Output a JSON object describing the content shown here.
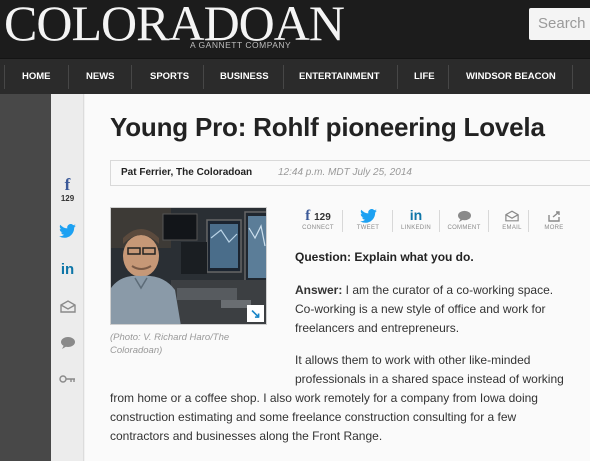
{
  "masthead": {
    "logo": "COLORADOAN",
    "tagline": "A GANNETT COMPANY",
    "search_placeholder": "Search"
  },
  "nav": {
    "items": [
      {
        "label": "HOME"
      },
      {
        "label": "NEWS"
      },
      {
        "label": "SPORTS"
      },
      {
        "label": "BUSINESS"
      },
      {
        "label": "ENTERTAINMENT"
      },
      {
        "label": "LIFE"
      },
      {
        "label": "WINDSOR BEACON"
      }
    ]
  },
  "share_rail": {
    "facebook_count": "129",
    "icons": [
      "facebook-icon",
      "twitter-icon",
      "linkedin-icon",
      "email-icon",
      "comment-icon",
      "more-icon"
    ]
  },
  "article": {
    "headline": "Young Pro: Rohlf pioneering Lovela",
    "author": "Pat Ferrier, The Coloradoan",
    "timestamp": "12:44 p.m. MDT July 25, 2014",
    "photo_caption": "(Photo: V. Richard Haro/The Coloradoan)",
    "question": "Question: Explain what you do.",
    "answer_label": "Answer:",
    "answer_lines": [
      " I am the curator of a co-working space.",
      "Co-working is a new style of office and work for",
      "freelancers and entrepreneurs."
    ],
    "para2_lines": [
      "It allows them to work with other like-minded",
      "professionals in a shared space instead of working",
      "from home or a coffee shop. I also work remotely for a company from Iowa doing",
      "construction estimating and some freelance construction consulting for a few",
      "contractors and businesses along the Front Range."
    ]
  },
  "share_bar": {
    "facebook_count": "129",
    "items": [
      {
        "label": "CONNECT"
      },
      {
        "label": "TWEET"
      },
      {
        "label": "LINKEDIN"
      },
      {
        "label": "COMMENT"
      },
      {
        "label": "EMAIL"
      },
      {
        "label": "MORE"
      }
    ]
  },
  "colors": {
    "masthead_bg": "#1c1c1c",
    "nav_bg": "#2b2b2b",
    "facebook": "#3b5998",
    "twitter": "#1da1f2",
    "linkedin": "#0e76a8",
    "icon_gray": "#8a8a8a"
  }
}
